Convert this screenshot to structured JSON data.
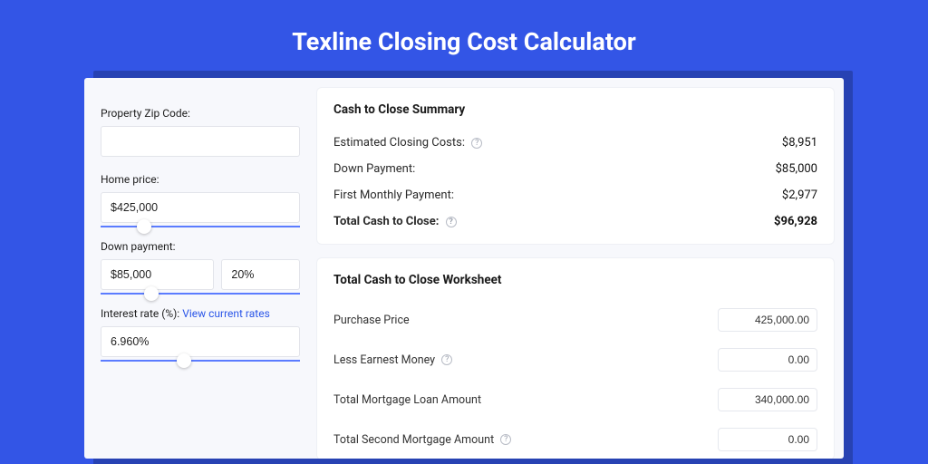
{
  "title": "Texline Closing Cost Calculator",
  "sidebar": {
    "zip_label": "Property Zip Code:",
    "zip_value": "",
    "home_price_label": "Home price:",
    "home_price_value": "$425,000",
    "down_payment_label": "Down payment:",
    "down_payment_value": "$85,000",
    "down_payment_pct": "20%",
    "interest_label_prefix": "Interest rate (%):",
    "interest_link": "View current rates",
    "interest_value": "6.960%",
    "slider_home_pos_pct": 18,
    "slider_dp_pos_pct": 22,
    "slider_rate_pos_pct": 38
  },
  "summary": {
    "title": "Cash to Close Summary",
    "rows": [
      {
        "label": "Estimated Closing Costs:",
        "help": true,
        "value": "$8,951"
      },
      {
        "label": "Down Payment:",
        "help": false,
        "value": "$85,000"
      },
      {
        "label": "First Monthly Payment:",
        "help": false,
        "value": "$2,977"
      }
    ],
    "total": {
      "label": "Total Cash to Close:",
      "help": true,
      "value": "$96,928"
    }
  },
  "worksheet": {
    "title": "Total Cash to Close Worksheet",
    "rows": [
      {
        "label": "Purchase Price",
        "help": false,
        "value": "425,000.00"
      },
      {
        "label": "Less Earnest Money",
        "help": true,
        "value": "0.00"
      },
      {
        "label": "Total Mortgage Loan Amount",
        "help": false,
        "value": "340,000.00"
      },
      {
        "label": "Total Second Mortgage Amount",
        "help": true,
        "value": "0.00"
      }
    ]
  }
}
